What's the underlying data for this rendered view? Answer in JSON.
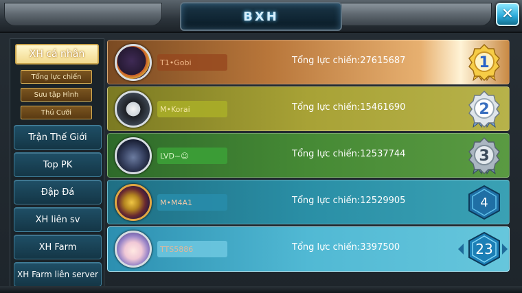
{
  "header": {
    "title": "BXH",
    "close_icon": "close-icon"
  },
  "sidebar": {
    "main_tab": "XH cá nhân",
    "subtabs": [
      "Tổng lực chiến",
      "Sưu tập Hình",
      "Thú Cưỡi"
    ],
    "buttons": [
      "Trận Thế Giới",
      "Top PK",
      "Đập Đá",
      "XH liên sv",
      "XH Farm",
      "XH Farm liên server"
    ]
  },
  "ranking": {
    "rows": [
      {
        "rank": "1",
        "name": "T1•Gobi",
        "power_label": "Tổng lực chiến:",
        "power_value": "27615687",
        "badge": "gold-medal-icon"
      },
      {
        "rank": "2",
        "name": "M•Korai",
        "power_label": "Tổng lực chiến:",
        "power_value": "15461690",
        "badge": "silver-medal-icon"
      },
      {
        "rank": "3",
        "name": "LVD~☺",
        "power_label": "Tổng lực chiến:",
        "power_value": "12537744",
        "badge": "bronze-medal-icon"
      },
      {
        "rank": "4",
        "name": "M•M4A1",
        "power_label": "Tổng lực chiến:",
        "power_value": "12529905",
        "badge": "hexagon-badge-icon"
      },
      {
        "rank": "23",
        "name": "TTS5886",
        "power_label": "Tổng lực chiến:",
        "power_value": "3397500",
        "badge": "hexagon-badge-icon"
      }
    ]
  },
  "colors": {
    "accent": "#2aa8d8",
    "gold": "#f2c23a",
    "silver": "#c9d3dc",
    "bronze": "#9aa7b3"
  }
}
